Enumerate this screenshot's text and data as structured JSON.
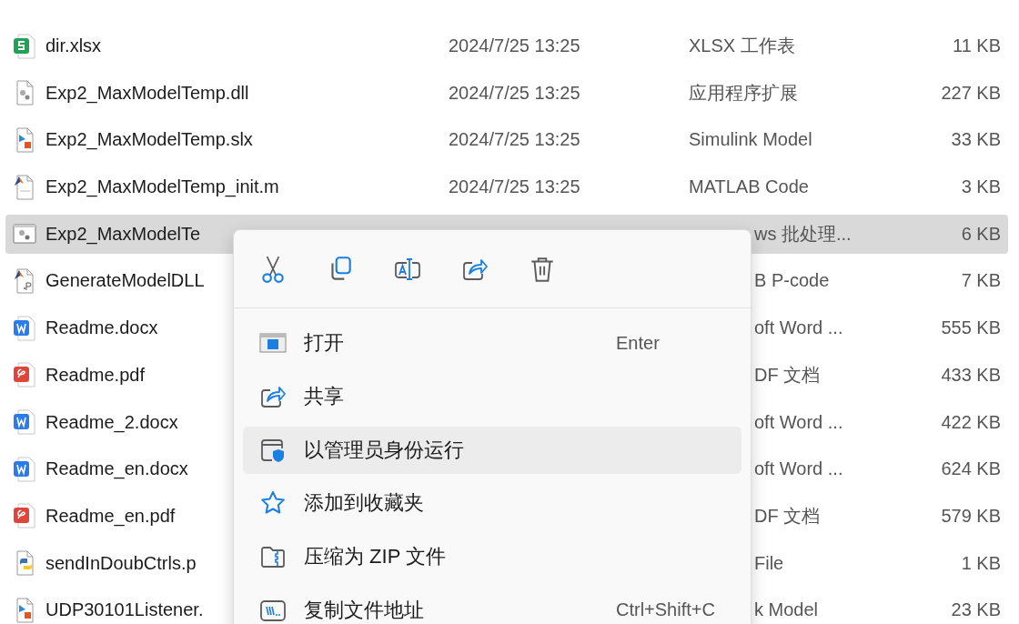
{
  "files": [
    {
      "kind": "sheet",
      "name": "dir.xlsx",
      "date": "2024/7/25 13:25",
      "type": "XLSX 工作表",
      "size": "11 KB",
      "selected": false
    },
    {
      "kind": "library",
      "name": "Exp2_MaxModelTemp.dll",
      "date": "2024/7/25 13:25",
      "type": "应用程序扩展",
      "size": "227 KB",
      "selected": false
    },
    {
      "kind": "model",
      "name": "Exp2_MaxModelTemp.slx",
      "date": "2024/7/25 13:25",
      "type": "Simulink Model",
      "size": "33 KB",
      "selected": false
    },
    {
      "kind": "script",
      "name": "Exp2_MaxModelTemp_init.m",
      "date": "2024/7/25 13:25",
      "type": "MATLAB Code",
      "size": "3 KB",
      "selected": false
    },
    {
      "kind": "batch",
      "name": "Exp2_MaxModelTe",
      "type": "ws 批处理...",
      "size": "6 KB",
      "selected": true
    },
    {
      "kind": "pcode",
      "name": "GenerateModelDLL",
      "type": "B P-code",
      "size": "7 KB",
      "selected": false
    },
    {
      "kind": "word",
      "name": "Readme.docx",
      "type": "oft Word ...",
      "size": "555 KB",
      "selected": false
    },
    {
      "kind": "pdf",
      "name": "Readme.pdf",
      "type": "DF 文档",
      "size": "433 KB",
      "selected": false
    },
    {
      "kind": "word",
      "name": "Readme_2.docx",
      "type": "oft Word ...",
      "size": "422 KB",
      "selected": false
    },
    {
      "kind": "word",
      "name": "Readme_en.docx",
      "type": "oft Word ...",
      "size": "624 KB",
      "selected": false
    },
    {
      "kind": "pdf",
      "name": "Readme_en.pdf",
      "type": "DF 文档",
      "size": "579 KB",
      "selected": false
    },
    {
      "kind": "python",
      "name": "sendInDoubCtrls.p",
      "type": "File",
      "size": "1 KB",
      "selected": false
    },
    {
      "kind": "model",
      "name": "UDP30101Listener.",
      "type": "k Model",
      "size": "23 KB",
      "selected": false
    }
  ],
  "context_menu": {
    "toolbar": [
      {
        "kind": "cut"
      },
      {
        "kind": "copy"
      },
      {
        "kind": "rename"
      },
      {
        "kind": "share"
      },
      {
        "kind": "delete"
      }
    ],
    "items": [
      {
        "kind": "open",
        "label": "打开",
        "shortcut": "Enter",
        "selected": false
      },
      {
        "kind": "share",
        "label": "共享",
        "selected": false
      },
      {
        "kind": "admin",
        "label": "以管理员身份运行",
        "selected": true
      },
      {
        "kind": "favorite",
        "label": "添加到收藏夹",
        "selected": false
      },
      {
        "kind": "zip",
        "label": "压缩为 ZIP 文件",
        "selected": false
      },
      {
        "kind": "path",
        "label": "复制文件地址",
        "shortcut": "Ctrl+Shift+C",
        "selected": false
      }
    ]
  }
}
